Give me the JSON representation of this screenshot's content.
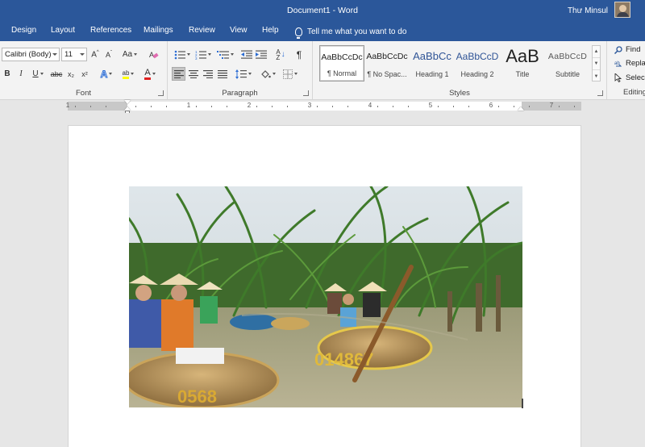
{
  "window": {
    "title": "Document1  -  Word",
    "user": "Thư Minsul"
  },
  "tabs": [
    "Design",
    "Layout",
    "References",
    "Mailings",
    "Review",
    "View",
    "Help"
  ],
  "tell_me": "Tell me what you want to do",
  "font": {
    "name": "Calibri (Body)",
    "size": "11",
    "group_label": "Font"
  },
  "paragraph": {
    "group_label": "Paragraph"
  },
  "styles": {
    "group_label": "Styles",
    "items": [
      {
        "preview": "AaBbCcDc",
        "name": "¶ Normal"
      },
      {
        "preview": "AaBbCcDc",
        "name": "¶ No Spac..."
      },
      {
        "preview": "AaBbCc",
        "name": "Heading 1"
      },
      {
        "preview": "AaBbCcD",
        "name": "Heading 2"
      },
      {
        "preview": "AaB",
        "name": "Title"
      },
      {
        "preview": "AaBbCcD",
        "name": "Subtitle"
      }
    ]
  },
  "editing": {
    "group_label": "Editing",
    "find": "Find",
    "replace": "Repla",
    "select": "Selec"
  },
  "ruler": {
    "numbers": [
      "1",
      "1",
      "2",
      "3",
      "4",
      "5",
      "6",
      "7"
    ]
  },
  "colors": {
    "accent": "#2b579a",
    "ribbon": "#f3f3f3",
    "canvas": "#e6e6e6",
    "highlight": "#ffff00",
    "font_color": "#e02020"
  },
  "icons": {
    "grow_font": "A^",
    "shrink_font": "Aˇ",
    "change_case": "Aa",
    "clear_format": "eraser-icon",
    "bold": "B",
    "italic": "I",
    "underline": "U",
    "strike": "abc",
    "subscript": "x₂",
    "superscript": "x²",
    "text_effects": "A",
    "highlight": "ab",
    "font_color": "A",
    "pilcrow": "¶",
    "sort": "A↓Z"
  }
}
